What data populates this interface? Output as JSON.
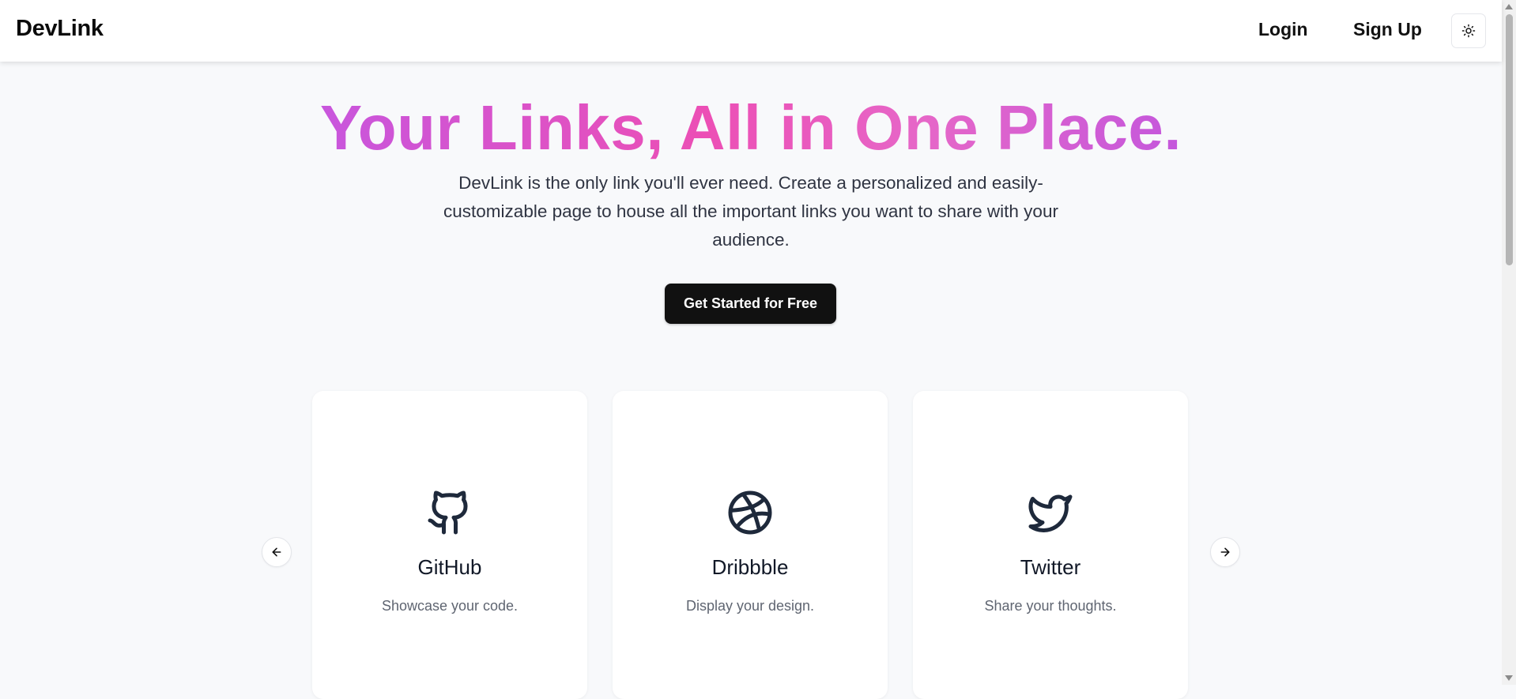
{
  "navbar": {
    "brand": "DevLink",
    "login": "Login",
    "signup": "Sign Up",
    "theme_icon": "sun-icon"
  },
  "hero": {
    "title": "Your Links, All in One Place.",
    "subtitle": "DevLink is the only link you'll ever need. Create a personalized and easily-customizable page to house all the important links you want to share with your audience.",
    "cta": "Get Started for Free",
    "gradient_colors": [
      "#c856dd",
      "#ec4fb5",
      "#c457dc"
    ]
  },
  "carousel": {
    "prev_icon": "arrow-left-icon",
    "next_icon": "arrow-right-icon",
    "cards": [
      {
        "icon": "github-icon",
        "title": "GitHub",
        "description": "Showcase your code."
      },
      {
        "icon": "dribbble-icon",
        "title": "Dribbble",
        "description": "Display your design."
      },
      {
        "icon": "twitter-icon",
        "title": "Twitter",
        "description": "Share your thoughts."
      }
    ]
  },
  "colors": {
    "background": "#f8f9fb",
    "button": "#111111",
    "icon": "#1e293b"
  }
}
